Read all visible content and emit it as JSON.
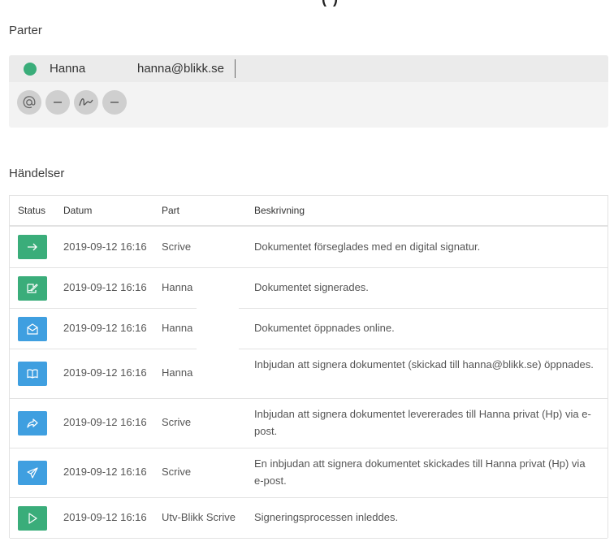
{
  "page": {
    "top_fragment": "(·)·"
  },
  "parter": {
    "title": "Parter",
    "party": {
      "name": "Hanna",
      "email": "hanna@blikk.se",
      "status_color": "#3aad7a"
    },
    "actions": [
      {
        "icon": "at-sign-icon"
      },
      {
        "icon": "minus-icon"
      },
      {
        "icon": "signature-icon"
      },
      {
        "icon": "minus-icon"
      }
    ]
  },
  "handelser": {
    "title": "Händelser",
    "columns": [
      "Status",
      "Datum",
      "Part",
      "Beskrivning"
    ],
    "rows": [
      {
        "icon": "arrow-right-icon",
        "color": "#3aad7a",
        "date": "2019-09-12 16:16",
        "part": "Scrive",
        "desc": "Dokumentet förseglades med en digital signatur."
      },
      {
        "icon": "signed-document-icon",
        "color": "#3aad7a",
        "date": "2019-09-12 16:16",
        "part": "Hanna",
        "desc": "Dokumentet signerades."
      },
      {
        "icon": "open-envelope-icon",
        "color": "#3f9fe0",
        "date": "2019-09-12 16:16",
        "part": "Hanna",
        "desc": "Dokumentet öppnades online."
      },
      {
        "icon": "open-book-icon",
        "color": "#3f9fe0",
        "date": "2019-09-12 16:16",
        "part": "Hanna",
        "desc": "Inbjudan att signera dokumentet (skickad till hanna@blikk.se) öppnades."
      },
      {
        "icon": "share-arrow-icon",
        "color": "#3f9fe0",
        "date": "2019-09-12 16:16",
        "part": "Scrive",
        "desc": "Inbjudan att signera dokumentet levererades till Hanna privat (Hp) via e-post."
      },
      {
        "icon": "paper-plane-icon",
        "color": "#3f9fe0",
        "date": "2019-09-12 16:16",
        "part": "Scrive",
        "desc": "En inbjudan att signera dokumentet skickades till Hanna privat (Hp) via e-post."
      },
      {
        "icon": "play-icon",
        "color": "#3aad7a",
        "date": "2019-09-12 16:16",
        "part": "Utv-Blikk Scrive",
        "desc": "Signeringsprocessen inleddes."
      }
    ]
  }
}
